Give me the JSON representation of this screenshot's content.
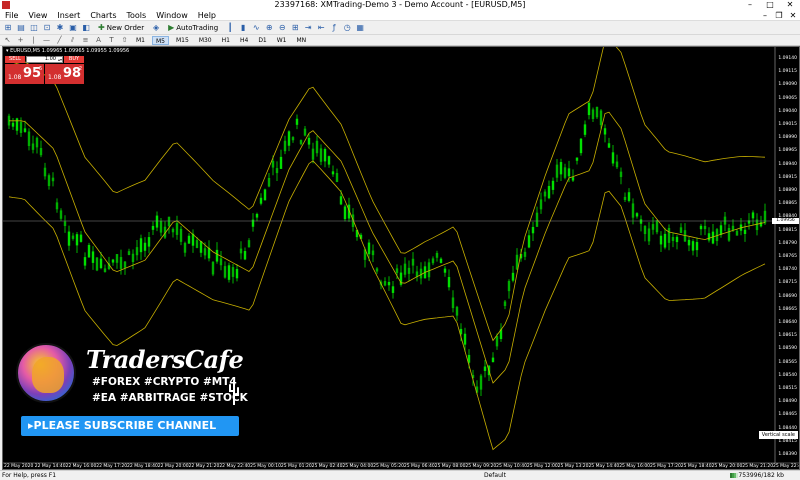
{
  "window": {
    "title": "23397168: XMTrading-Demo 3 - Demo Account - [EURUSD,M5]",
    "buttons": [
      "–",
      "□",
      "✕"
    ]
  },
  "menu": {
    "items": [
      "File",
      "View",
      "Insert",
      "Charts",
      "Tools",
      "Window",
      "Help"
    ],
    "mdi_buttons": [
      "–",
      "❐",
      "✕"
    ]
  },
  "toolbar": {
    "new_order_label": "New Order",
    "autotrading_label": "AutoTrading"
  },
  "timeframes": [
    "M1",
    "M5",
    "M15",
    "M30",
    "H1",
    "H4",
    "D1",
    "W1",
    "MN"
  ],
  "active_timeframe": "M5",
  "chart": {
    "header": "EURUSD,M5  1.09965 1.09965 1.09955 1.09956",
    "current_price_tag": "1.09956",
    "vertical_scale_label": "Vertical scale",
    "price_labels": [
      "1.09140",
      "1.09115",
      "1.09090",
      "1.09065",
      "1.09040",
      "1.09015",
      "1.08990",
      "1.08965",
      "1.08940",
      "1.08915",
      "1.08890",
      "1.08865",
      "1.08840",
      "1.08815",
      "1.08790",
      "1.08765",
      "1.08740",
      "1.08715",
      "1.08690",
      "1.08665",
      "1.08640",
      "1.08615",
      "1.08590",
      "1.08565",
      "1.08540",
      "1.08515",
      "1.08490",
      "1.08465",
      "1.08440",
      "1.08415",
      "1.08390"
    ],
    "time_labels": [
      "22 May 2020",
      "22 May 14:40",
      "22 May 16:00",
      "22 May 17:20",
      "22 May 18:40",
      "22 May 20:00",
      "22 May 21:20",
      "22 May 22:40",
      "25 May 00:10",
      "25 May 01:20",
      "25 May 02:40",
      "25 May 04:00",
      "25 May 05:20",
      "25 May 06:40",
      "25 May 08:00",
      "25 May 09:20",
      "25 May 10:40",
      "25 May 12:00",
      "25 May 13:20",
      "25 May 14:40",
      "25 May 16:00",
      "25 May 17:20",
      "25 May 18:40",
      "25 May 20:00",
      "25 May 21:20",
      "25 May 22:40"
    ]
  },
  "trade_panel": {
    "sell_label": "SELL",
    "buy_label": "BUY",
    "lot": "1.00",
    "sell_price_prefix": "1.08",
    "sell_price_big": "95",
    "sell_price_sup": "6",
    "buy_price_prefix": "1.08",
    "buy_price_big": "98",
    "buy_price_sup": "2"
  },
  "promo": {
    "brand": "TradersCafe",
    "tags_line1": "#FOREX #CRYPTO #MT4",
    "tags_line2": "#EA #ARBITRAGE #STOCK",
    "subscribe": "▸PLEASE SUBSCRIBE CHANNEL"
  },
  "status": {
    "help": "For Help, press F1",
    "profile": "Default",
    "traffic": "753996/182 kb"
  },
  "colors": {
    "bull_candle": "#00e000",
    "bear_candle": "#00b000",
    "bands": "#c8b000",
    "grid_bg": "#000000",
    "button_red": "#e53935",
    "subscribe_blue": "#2196f3"
  }
}
